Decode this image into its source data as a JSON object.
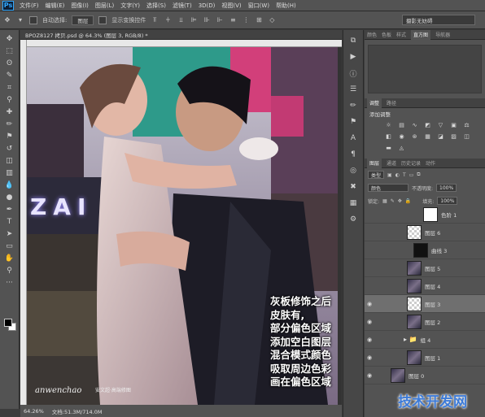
{
  "app": {
    "logo": "Ps"
  },
  "menu": [
    "文件(F)",
    "编辑(E)",
    "图像(I)",
    "图层(L)",
    "文字(Y)",
    "选择(S)",
    "滤镜(T)",
    "3D(D)",
    "视图(V)",
    "窗口(W)",
    "帮助(H)"
  ],
  "options_bar": {
    "auto_select_label": "自动选择:",
    "auto_select_value": "图层",
    "show_transform_label": "显示变换控件",
    "workspace_value": "摄影无妨碍"
  },
  "document_tab": {
    "title": "BPOZ8127 拷贝.psd @ 64.3% (图层 3, RGB/8) *"
  },
  "status_bar": {
    "zoom": "64.26%",
    "doc_info": "文档:51.3M/714.0M"
  },
  "canvas": {
    "sign_text": "ZAI",
    "overlay_lines": [
      "灰板修饰之后",
      "皮肤有,",
      "部分偏色区域",
      "添加空白图层",
      "混合模式颜色",
      "吸取周边色彩",
      "画在偏色区域"
    ],
    "watermark": "anwenchao",
    "watermark_sub": "安文超·高端修图"
  },
  "panels": {
    "top_tabs": [
      "颜色",
      "色板",
      "样式",
      "直方图",
      "导航器"
    ],
    "active_top_tab": "直方图",
    "adjust_tabs": [
      "调整",
      "路径"
    ],
    "adjust_title": "添加调整",
    "layer_tabs": [
      "图层",
      "通道",
      "历史记录",
      "动作"
    ],
    "kind_label": "类型",
    "blend_mode": "颜色",
    "opacity_label": "不透明度:",
    "opacity_value": "100%",
    "lock_label": "锁定:",
    "fill_label": "填充:",
    "fill_value": "100%"
  },
  "layers": [
    {
      "name": "色阶 1",
      "thumb": "white",
      "visible": false,
      "selected": false
    },
    {
      "name": "图层 6",
      "thumb": "checker",
      "visible": false,
      "selected": false
    },
    {
      "name": "曲线 3",
      "thumb": "mask",
      "visible": false,
      "selected": false
    },
    {
      "name": "图层 5",
      "thumb": "photo",
      "visible": false,
      "selected": false
    },
    {
      "name": "图层 4",
      "thumb": "photo",
      "visible": false,
      "selected": false
    },
    {
      "name": "图层 3",
      "thumb": "checker",
      "visible": true,
      "selected": true
    },
    {
      "name": "图层 2",
      "thumb": "photo",
      "visible": true,
      "selected": false
    },
    {
      "name": "组 4",
      "thumb": "folder",
      "visible": true,
      "selected": false
    },
    {
      "name": "图层 1",
      "thumb": "photo",
      "visible": true,
      "selected": false
    },
    {
      "name": "图层 0",
      "thumb": "photo",
      "visible": true,
      "selected": false
    }
  ],
  "corner_logo": "技术开发网"
}
